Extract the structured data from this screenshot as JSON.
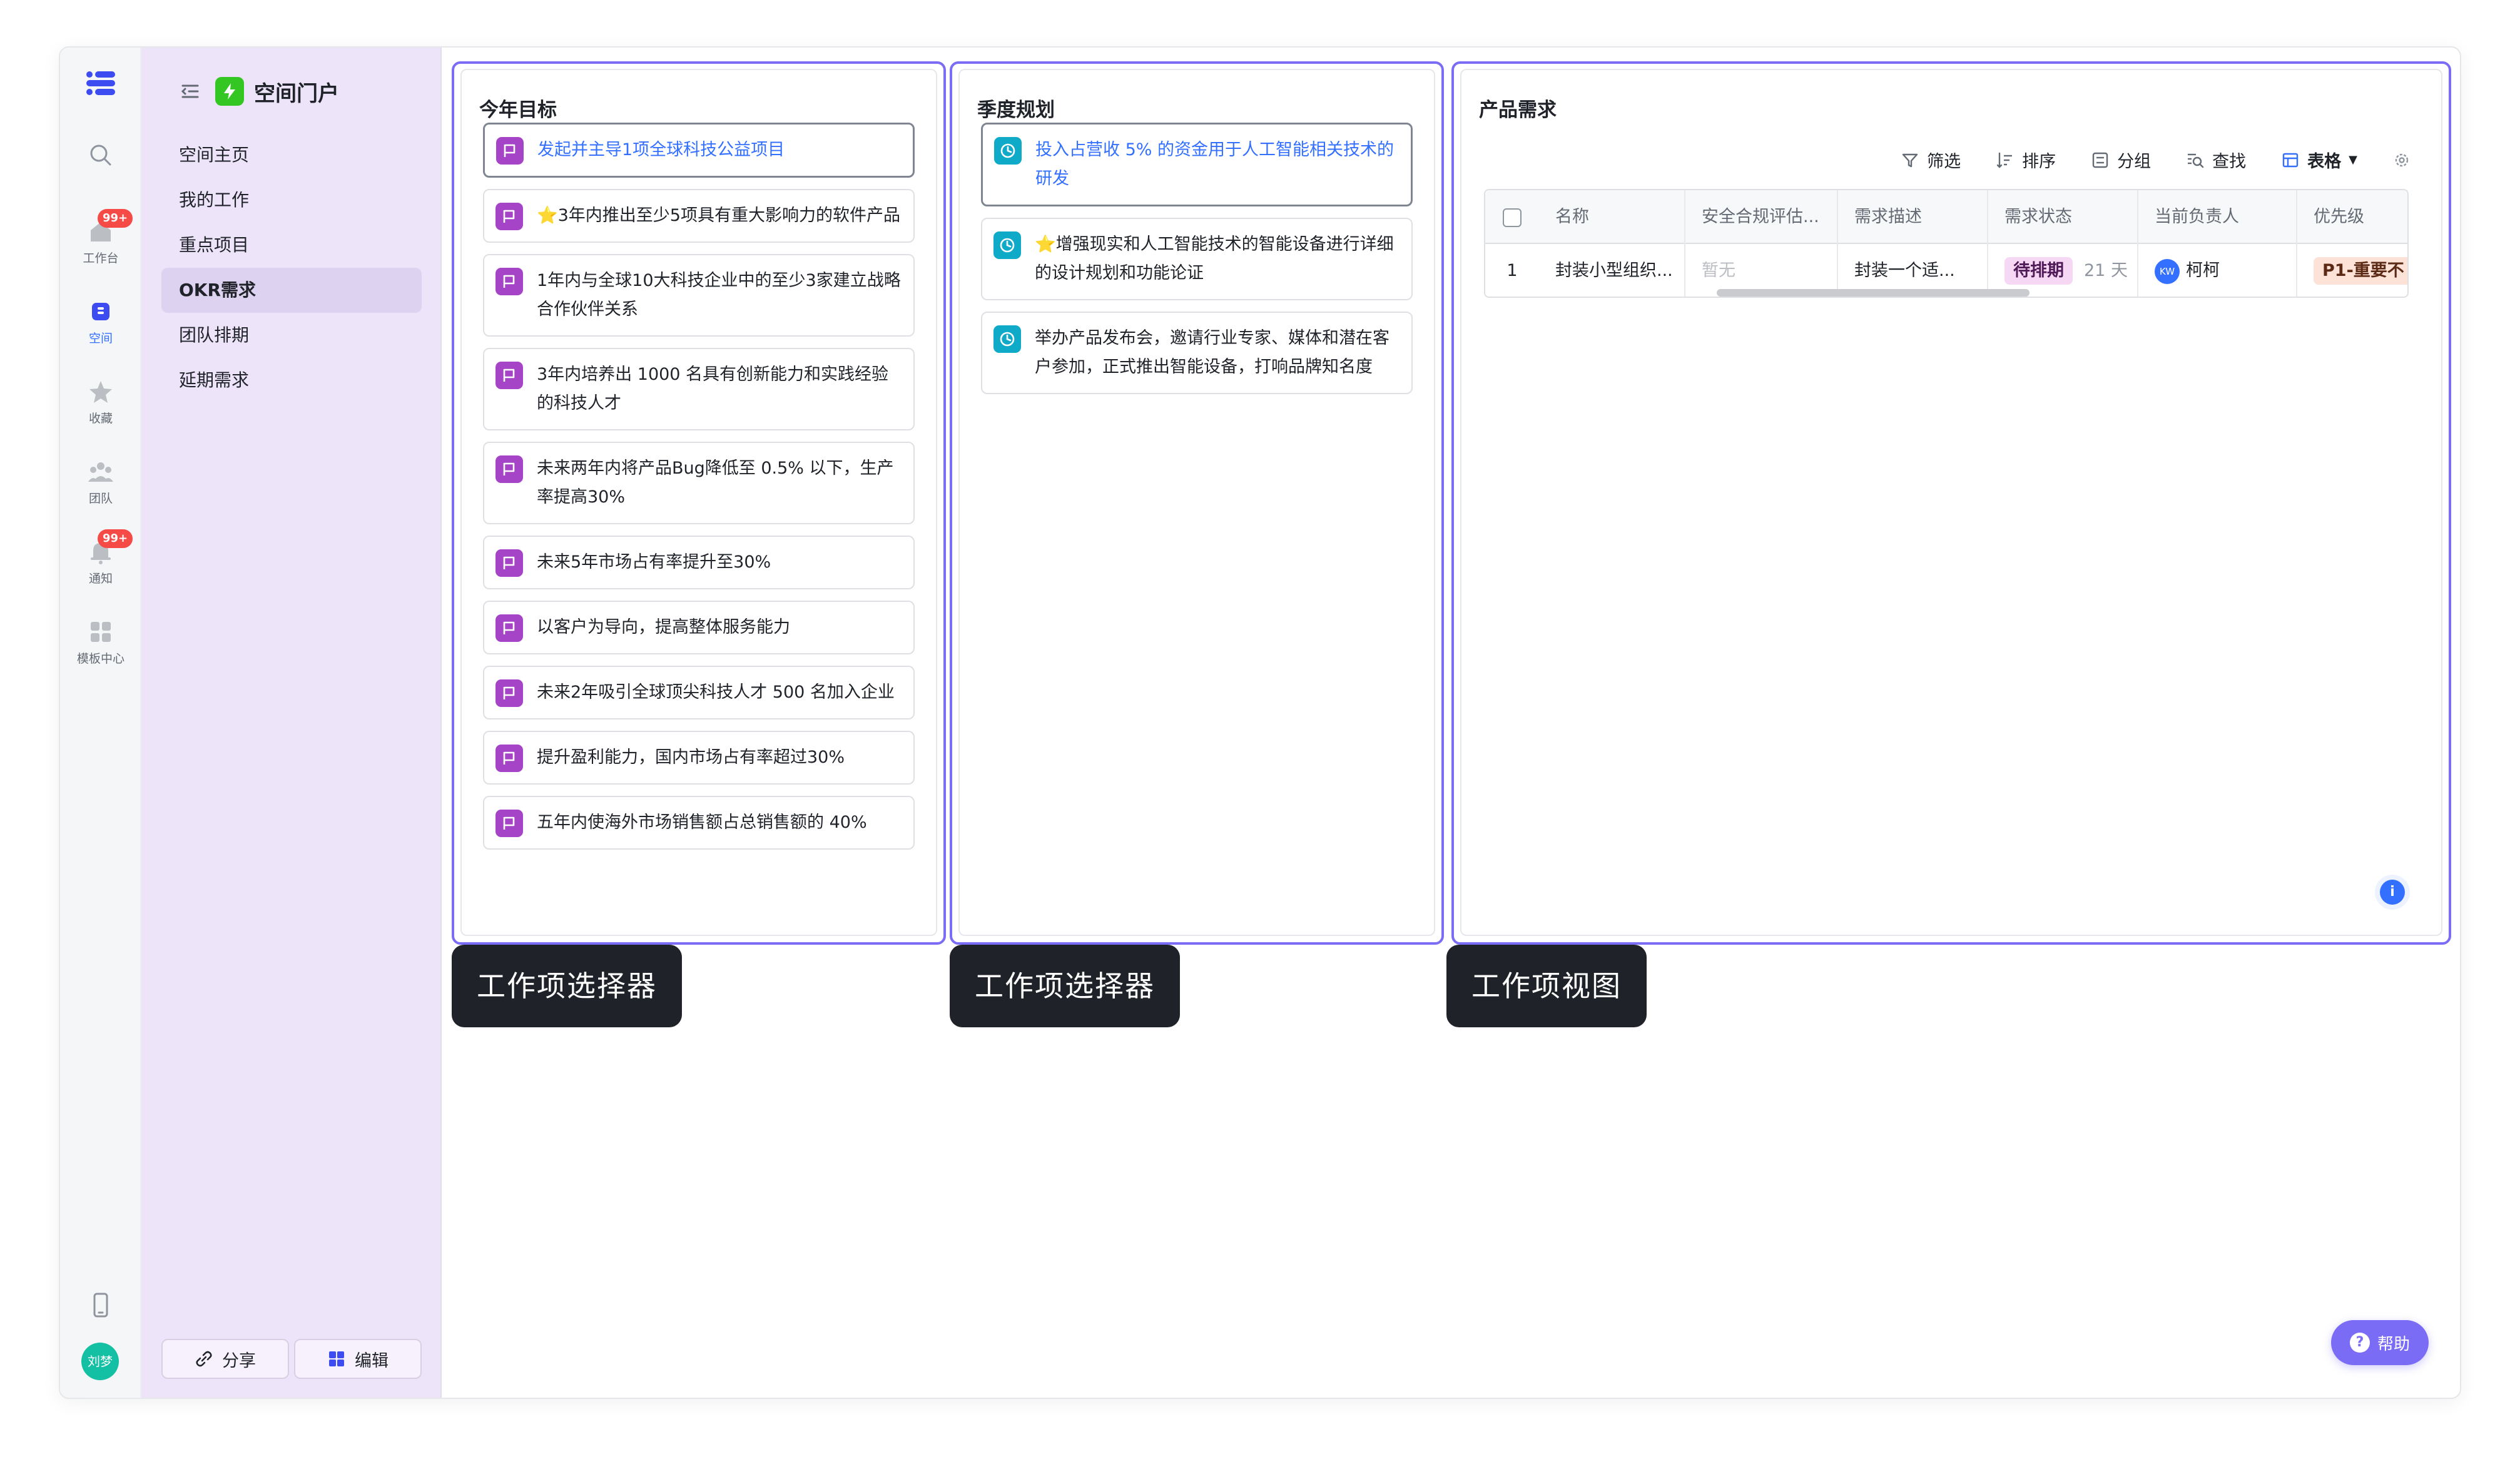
{
  "rail": {
    "items": [
      {
        "label": "工作台",
        "badge": "99+"
      },
      {
        "label": "空间"
      },
      {
        "label": "收藏"
      },
      {
        "label": "团队"
      },
      {
        "label": "通知",
        "badge": "99+"
      },
      {
        "label": "模板中心"
      }
    ],
    "avatar": "刘梦"
  },
  "sidebar": {
    "title": "空间门户",
    "nav": [
      "空间主页",
      "我的工作",
      "重点项目",
      "OKR需求",
      "团队排期",
      "延期需求"
    ],
    "share_label": "分享",
    "edit_label": "编辑"
  },
  "panel_goals": {
    "title": "今年目标",
    "items": [
      "发起并主导1项全球科技公益项目",
      "⭐3年内推出至少5项具有重大影响力的软件产品",
      "1年内与全球10大科技企业中的至少3家建立战略合作伙伴关系",
      "3年内培养出 1000 名具有创新能力和实践经验的科技人才",
      "未来两年内将产品Bug降低至 0.5% 以下，生产率提高30%",
      "未来5年市场占有率提升至30%",
      "以客户为导向，提高整体服务能力",
      "未来2年吸引全球顶尖科技人才 500 名加入企业",
      "提升盈利能力，国内市场占有率超过30%",
      "五年内使海外市场销售额占总销售额的 40%"
    ]
  },
  "panel_quarter": {
    "title": "季度规划",
    "items": [
      "投入占营收 5% 的资金用于人工智能相关技术的研发",
      "⭐增强现实和人工智能技术的智能设备进行详细的设计规划和功能论证",
      "举办产品发布会，邀请行业专家、媒体和潜在客户参加，正式推出智能设备，打响品牌知名度"
    ]
  },
  "panel_requirements": {
    "title": "产品需求",
    "toolbar": {
      "filter": "筛选",
      "sort": "排序",
      "group": "分组",
      "find": "查找",
      "view": "表格"
    },
    "table": {
      "columns": [
        "名称",
        "安全合规评估...",
        "需求描述",
        "需求状态",
        "当前负责人",
        "优先级"
      ],
      "rows": [
        {
          "index": "1",
          "name": "封装小型组织...",
          "compliance": "暂无",
          "description": "封装一个适...",
          "status": "待排期",
          "days": "21 天",
          "owner_initials": "KW",
          "owner": "柯柯",
          "priority": "P1-重要不"
        }
      ]
    },
    "info_icon": "i"
  },
  "tags": {
    "selector1": "工作项选择器",
    "selector2": "工作项选择器",
    "view": "工作项视图"
  },
  "help_label": "帮助"
}
